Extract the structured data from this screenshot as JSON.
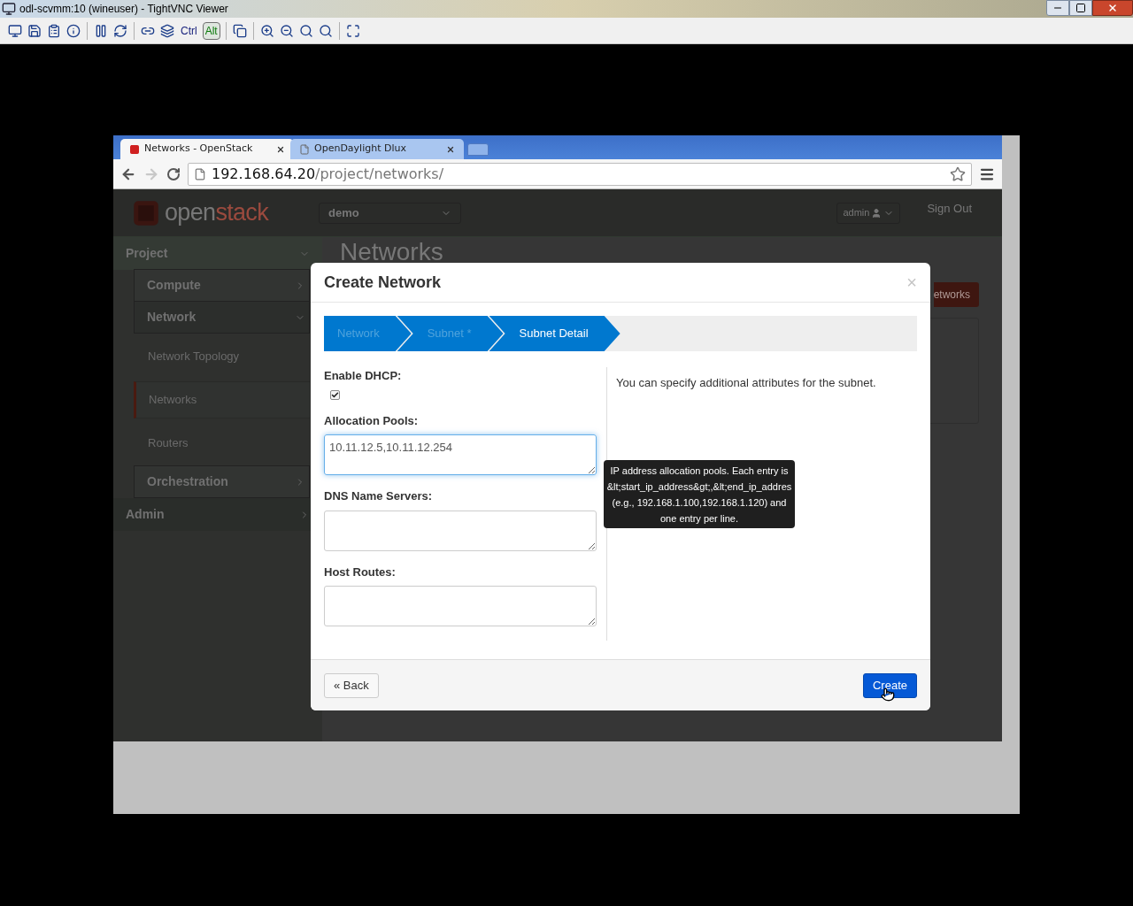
{
  "vnc_window": {
    "title": "odl-scvmm:10 (wineuser) - TightVNC Viewer",
    "keys": [
      {
        "label": "Ctrl",
        "pressed": false
      },
      {
        "label": "Alt",
        "pressed": true
      }
    ]
  },
  "browser": {
    "tabs": [
      {
        "title": "Networks - OpenStack",
        "selected": true
      },
      {
        "title": "OpenDaylight Dlux",
        "selected": false
      }
    ],
    "address": {
      "host": "192.168.64.20",
      "path": "/project/networks/"
    }
  },
  "page": {
    "logo": {
      "part_1": "open",
      "part_2": "stack"
    },
    "project_select": "demo",
    "user_menu": "admin",
    "sign_out": "Sign Out",
    "title": "Networks",
    "action_button": "etworks"
  },
  "sidebar": [
    {
      "label": "Project",
      "expanded": true,
      "children": [
        {
          "label": "Compute",
          "expanded": false
        },
        {
          "label": "Network",
          "expanded": true,
          "children": [
            {
              "label": "Network Topology",
              "selected": false
            },
            {
              "label": "Networks",
              "selected": true
            },
            {
              "label": "Routers",
              "selected": false
            }
          ]
        },
        {
          "label": "Orchestration",
          "expanded": false
        }
      ]
    },
    {
      "label": "Admin",
      "expanded": false
    }
  ],
  "modal": {
    "title": "Create Network",
    "close": "×",
    "steps": [
      {
        "label": "Network",
        "selected": false
      },
      {
        "label": "Subnet *",
        "selected": false
      },
      {
        "label": "Subnet Detail",
        "selected": true
      }
    ],
    "fields": [
      {
        "kind": "checkbox",
        "label": "Enable DHCP:",
        "checked": true
      },
      {
        "kind": "textarea",
        "label": "Allocation Pools:",
        "value": "10.11.12.5,10.11.12.254",
        "focused": true
      },
      {
        "kind": "textarea",
        "label": "DNS Name Servers:",
        "focused": false
      },
      {
        "kind": "textarea",
        "label": "Host Routes:",
        "focused": false
      }
    ],
    "help": "You can specify additional attributes for the subnet.",
    "tooltip": [
      "IP address allocation pools. Each entry is",
      "&lt;start_ip_address&gt;,&lt;end_ip_addres",
      "(e.g., 192.168.1.100,192.168.1.120) and",
      "one entry per line."
    ],
    "back_button": "« Back",
    "create_button": "Create"
  }
}
